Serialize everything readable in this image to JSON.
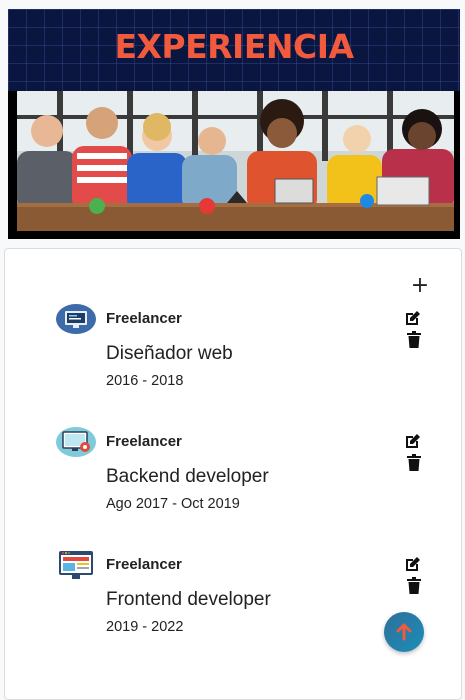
{
  "banner": {
    "title": "EXPERIENCIA",
    "title_color": "#f15a3c",
    "background_color": "#0a1540",
    "image": "people-using-devices-photo"
  },
  "section": {
    "add_icon": "plus-icon",
    "add_label": "+"
  },
  "experiences": [
    {
      "company": "Freelancer",
      "position": "Diseñador web",
      "dates": "2016 - 2018",
      "logo": "monitor-code-logo",
      "edit_icon": "edit-icon",
      "delete_icon": "trash-icon"
    },
    {
      "company": "Freelancer",
      "position": "Backend developer",
      "dates": "Ago 2017 - Oct 2019",
      "logo": "computer-gear-logo",
      "edit_icon": "edit-icon",
      "delete_icon": "trash-icon"
    },
    {
      "company": "Freelancer",
      "position": "Frontend developer",
      "dates": "2019 - 2022",
      "logo": "browser-window-logo",
      "edit_icon": "edit-icon",
      "delete_icon": "trash-icon"
    }
  ],
  "scroll_top": {
    "icon": "arrow-up-icon",
    "arrow_color": "#f15a3c"
  }
}
